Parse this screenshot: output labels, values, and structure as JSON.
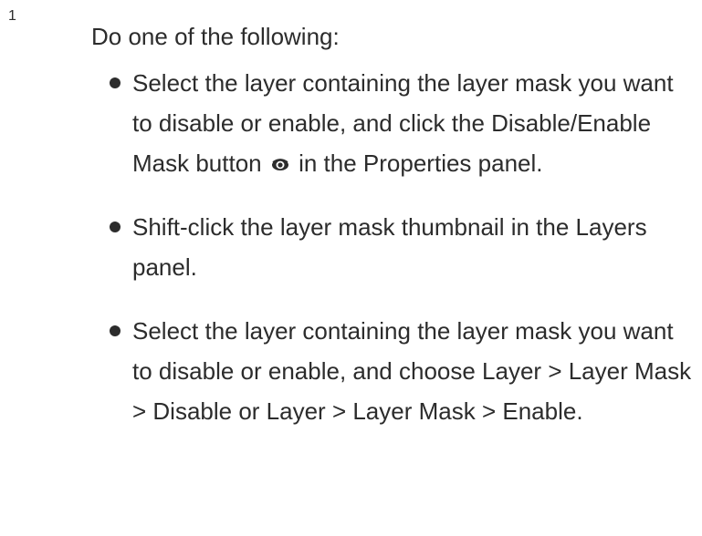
{
  "step": {
    "number": "1",
    "intro": "Do one of the following:",
    "bullets": [
      {
        "before_icon": "Select the layer containing the layer mask you want to disable or enable, and click the Disable/Enable Mask button",
        "icon": "eye-icon",
        "after_icon": " in the Properties panel."
      },
      {
        "text": "Shift-click the layer mask thumbnail in the Layers panel."
      },
      {
        "text": "Select the layer containing the layer mask you want to disable or enable, and choose Layer > Layer Mask > Disable or Layer > Layer Mask > Enable."
      }
    ]
  },
  "colors": {
    "text": "#2c2c2c",
    "background": "#ffffff"
  }
}
